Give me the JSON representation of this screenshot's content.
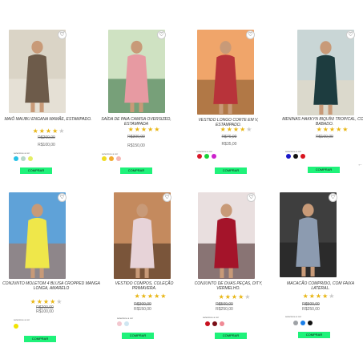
{
  "products": [
    {
      "name": "MAIÔ MAUBU ENGANA MAMÃE, ESTAMPADO.",
      "stars": 4,
      "old_price": "R$200,00",
      "price": "R$100,00",
      "select_label": "selecione a cor",
      "colors": [
        "#27c2e6",
        "#b9d9c9",
        "#e4ee66"
      ],
      "buy_label": "COMPRAR",
      "photo": {
        "bg": "#dad4c6",
        "figure": "#6d5b4a",
        "accent": "#eeeae2"
      }
    },
    {
      "name": "SAÍDA DE PAIA CAMISA OVERSIZED, ESTAMPADA",
      "stars": 5,
      "old_price": "R$300,00",
      "price": "R$150,00",
      "select_label": "selecione a cor",
      "colors": [
        "#f0dc22",
        "#f2ab32",
        "#f6b8b5"
      ],
      "buy_label": "COMPRAR",
      "photo": {
        "bg": "#cfe2c2",
        "figure": "#e79aa2",
        "accent": "#2f6a3e"
      }
    },
    {
      "name": "VESTIDO LONGO CORTE EM V, ESTAMPADO.",
      "stars": 4,
      "old_price": "R$70,00",
      "price": "R$35,00",
      "select_label": "selecione a cor",
      "colors": [
        "#d9182a",
        "#1ad23a",
        "#cc22cc"
      ],
      "buy_label": "COMPRAR",
      "photo": {
        "bg": "#f0a56a",
        "figure": "#b8333a",
        "accent": "#7e5428"
      }
    },
    {
      "name": "MENINAS HAKKYN BIQUÍNI TROPICAL, COM BABADO.",
      "stars": 5,
      "old_price": "R$100,00",
      "price": "",
      "select_label": "selecione a cor",
      "colors": [
        "#1a18c8",
        "#111111",
        "#d8131e"
      ],
      "buy_label": "COMPRAR",
      "photo": {
        "bg": "#c9d6d6",
        "figure": "#1d3c3f",
        "accent": "#e9ddc4"
      }
    },
    {
      "name": "CONJUNTO MOLETOM 4 BLUSA CROPPED MANGA LONGA, AMARELO",
      "stars": 4,
      "old_price": "R$200,00",
      "price": "R$100,00",
      "select_label": "selecione a cor",
      "colors": [
        "#f1e400"
      ],
      "buy_label": "COMPRAR",
      "photo": {
        "bg": "#5fa2d8",
        "figure": "#efe74a",
        "accent": "#b4704a"
      }
    },
    {
      "name": "VESTIDO COMPOS, COLEÇÃO PRIMAVERA.",
      "stars": 5,
      "old_price": "R$300,00",
      "price": "R$150,00",
      "select_label": "selecione a cor",
      "colors": [
        "#f3c7cf",
        "#cfe6f1"
      ],
      "buy_label": "COMPRAR",
      "photo": {
        "bg": "#c48a5e",
        "figure": "#e7d3d8",
        "accent": "#3e2a1e"
      }
    },
    {
      "name": "CONJUNTO DE DUAS PEÇAS, DITY, VERMELHO.",
      "stars": 4,
      "old_price": "R$500,00",
      "price": "R$250,00",
      "select_label": "selecione a cor",
      "colors": [
        "#c8101e",
        "#7a0e16",
        "#f08a95"
      ],
      "buy_label": "COMPRAR",
      "photo": {
        "bg": "#e9dfdf",
        "figure": "#a4142a",
        "accent": "#3b1b1b"
      }
    },
    {
      "name": "MACACÃO COMPRIDO, COM FAIXA LATERAL.",
      "stars": 4,
      "old_price": "R$500,00",
      "price": "R$250,00",
      "select_label": "selecione a cor",
      "colors": [
        "#9ea2a6",
        "#1a7ee8",
        "#111111"
      ],
      "buy_label": "COMPRAR",
      "photo": {
        "bg": "#3e3e3e",
        "figure": "#8c9bb0",
        "accent": "#1c1c1c"
      }
    }
  ]
}
